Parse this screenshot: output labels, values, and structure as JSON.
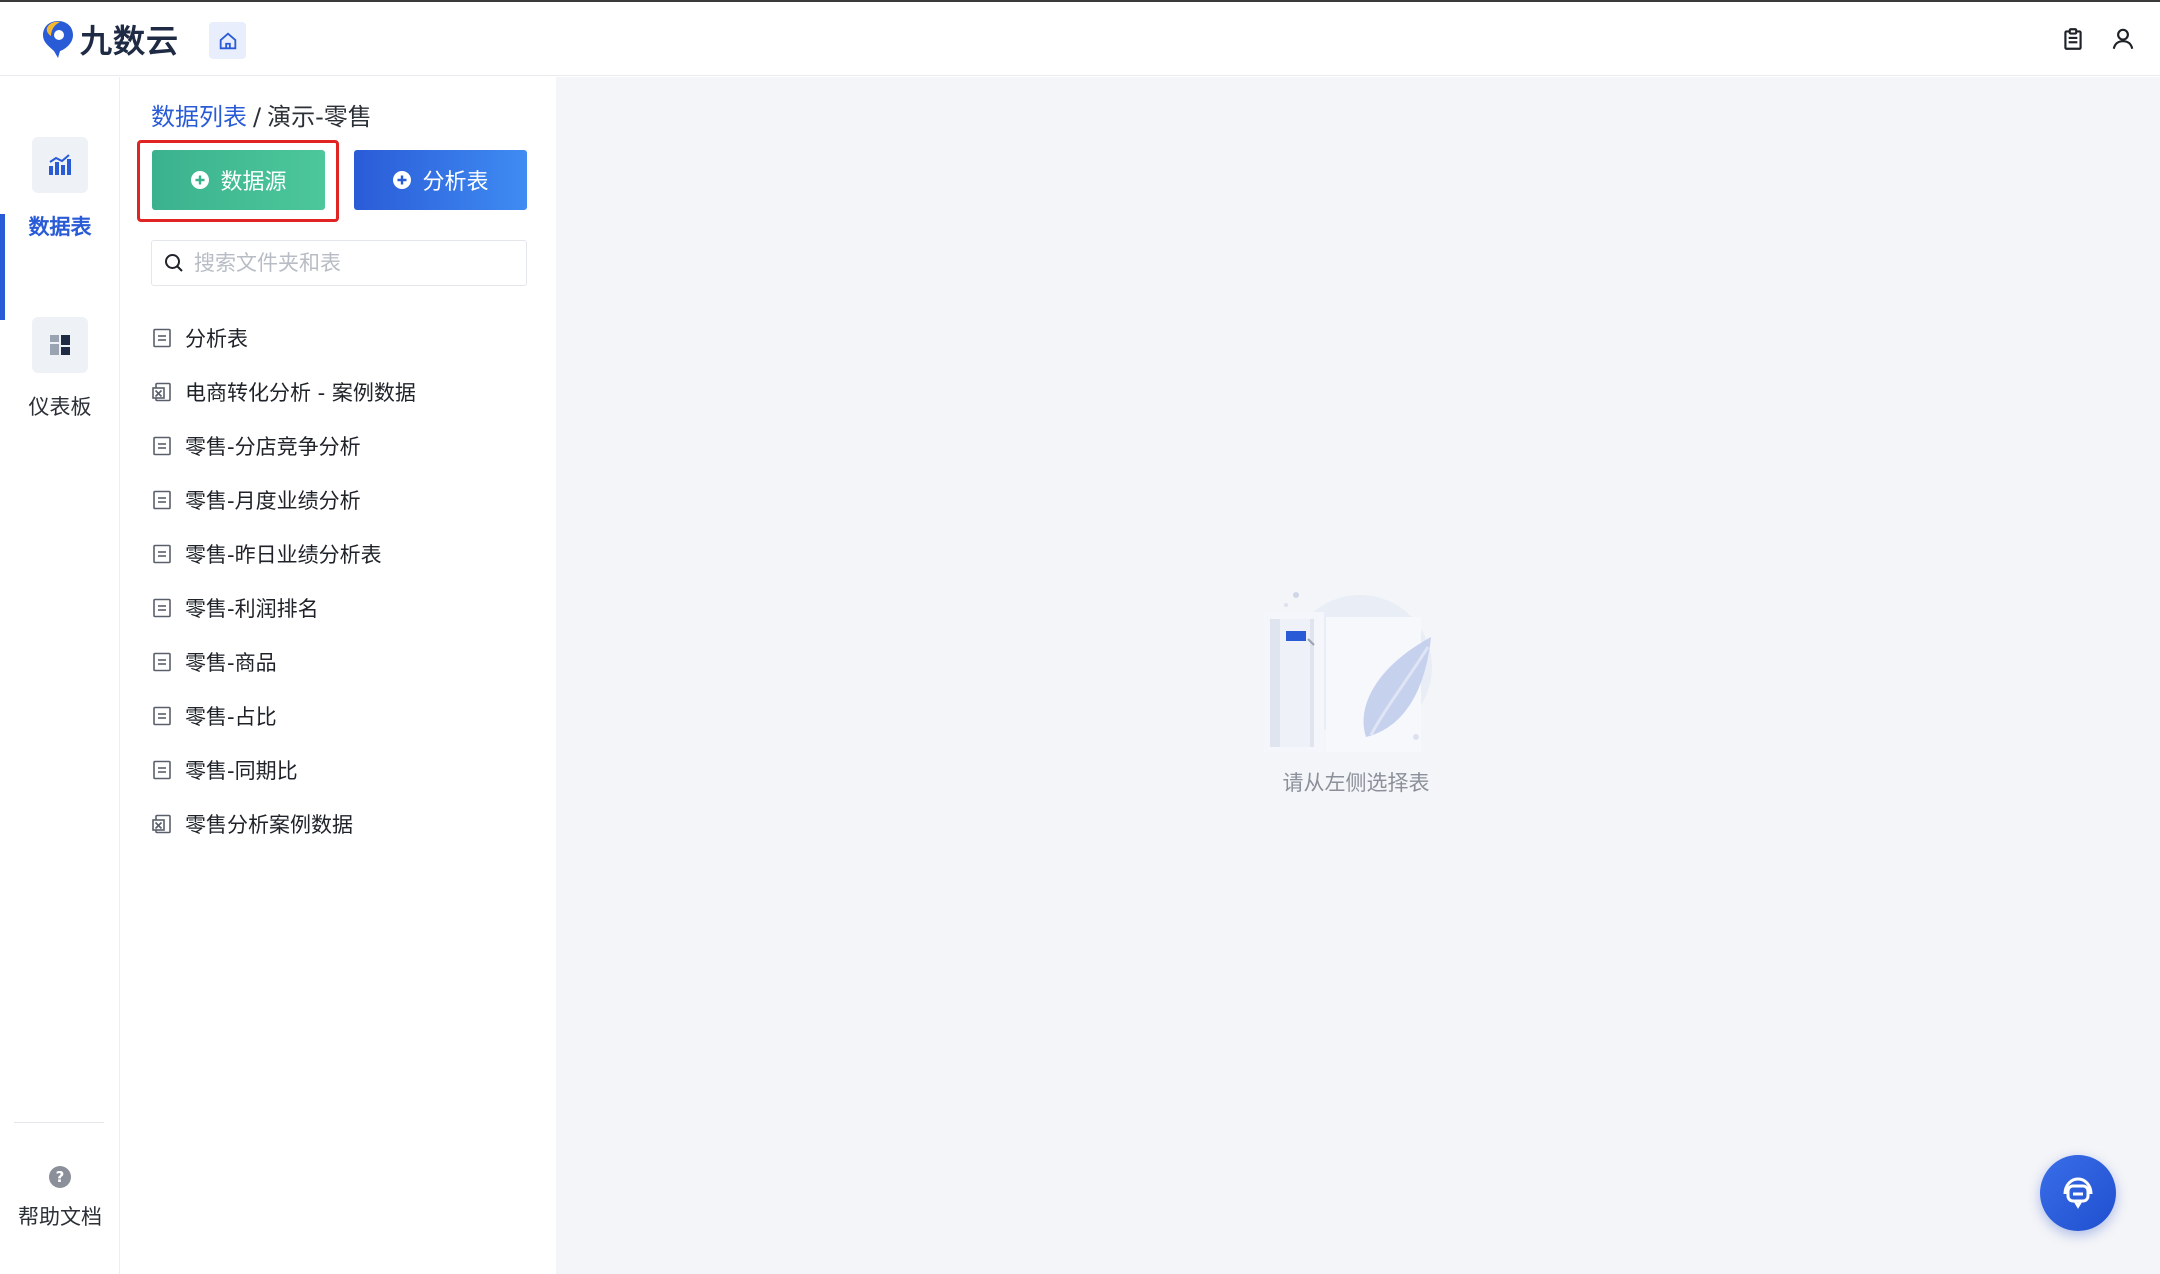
{
  "app": {
    "brand": "九数云",
    "brand_color": "#2a5bd7"
  },
  "topbar": {
    "home_icon": "home-icon",
    "right_icons": [
      "clipboard-icon",
      "user-icon"
    ]
  },
  "nav": {
    "items": [
      {
        "label": "数据表",
        "icon": "bar-chart-icon",
        "active": true
      },
      {
        "label": "仪表板",
        "icon": "dashboard-icon",
        "active": false
      }
    ],
    "help_label": "帮助文档"
  },
  "panel": {
    "breadcrumb": {
      "link": "数据列表",
      "separator": "/",
      "current": "演示-零售"
    },
    "buttons": {
      "source_label": "数据源",
      "analysis_label": "分析表"
    },
    "search": {
      "placeholder": "搜索文件夹和表",
      "value": ""
    },
    "files": [
      {
        "name": "分析表",
        "type": "table"
      },
      {
        "name": "电商转化分析 - 案例数据",
        "type": "excel"
      },
      {
        "name": "零售-分店竞争分析",
        "type": "table"
      },
      {
        "name": "零售-月度业绩分析",
        "type": "table"
      },
      {
        "name": "零售-昨日业绩分析表",
        "type": "table"
      },
      {
        "name": "零售-利润排名",
        "type": "table"
      },
      {
        "name": "零售-商品",
        "type": "table"
      },
      {
        "name": "零售-占比",
        "type": "table"
      },
      {
        "name": "零售-同期比",
        "type": "table"
      },
      {
        "name": "零售分析案例数据",
        "type": "excel"
      }
    ]
  },
  "content": {
    "empty_message": "请从左侧选择表"
  },
  "colors": {
    "source_button": "#3bb28e",
    "analysis_button": "#2a5bd7",
    "highlight": "#e02424"
  }
}
